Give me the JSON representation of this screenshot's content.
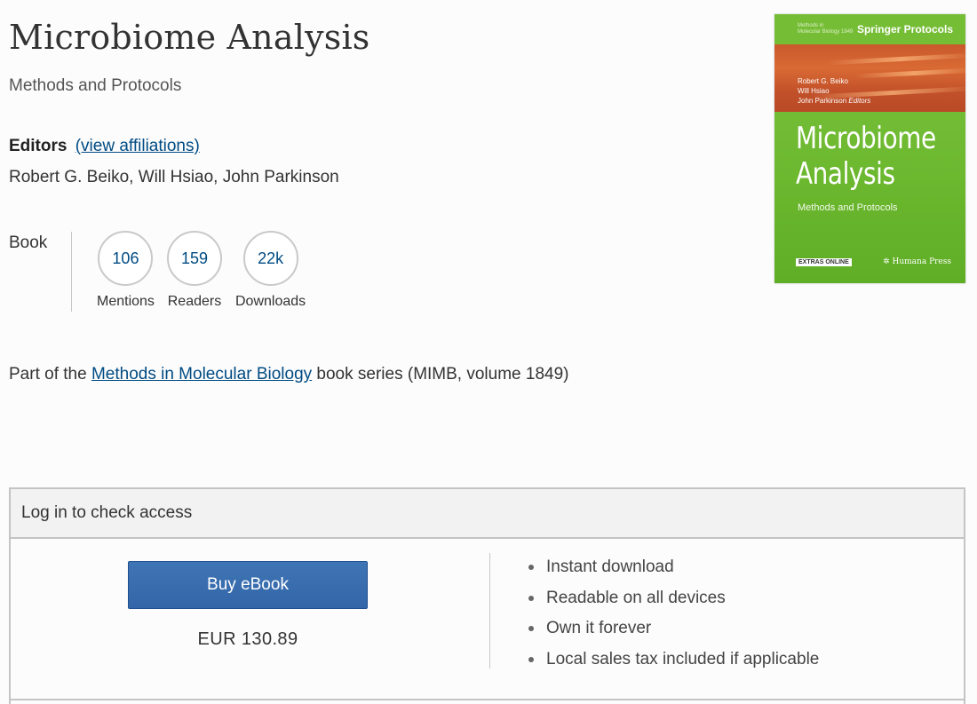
{
  "book": {
    "title": "Microbiome Analysis",
    "subtitle": "Methods and Protocols",
    "editors_label": "Editors",
    "affiliations_link": "(view affiliations)",
    "editors": "Robert G. Beiko, Will Hsiao, John Parkinson"
  },
  "metrics": {
    "type_label": "Book",
    "items": [
      {
        "value": "106",
        "label": "Mentions"
      },
      {
        "value": "159",
        "label": "Readers"
      },
      {
        "value": "22k",
        "label": "Downloads"
      }
    ]
  },
  "series": {
    "prefix": "Part of the",
    "link": "Methods in Molecular Biology",
    "suffix": "book series (MIMB, volume 1849)"
  },
  "cover": {
    "series_small_1": "Methods in",
    "series_small_2": "Molecular Biology  1849",
    "publisher": "Springer Protocols",
    "editor_1": "Robert G. Beiko",
    "editor_2": "Will Hsiao",
    "editor_3": "John Parkinson",
    "editors_tag": "Editors",
    "title_line1": "Microbiome",
    "title_line2": "Analysis",
    "subtitle": "Methods and Protocols",
    "extras": "EXTRAS ONLINE",
    "imprint": "Humana Press",
    "colors": {
      "green": "#6cb82f",
      "orange": "#c9582c"
    }
  },
  "access": {
    "header": "Log in to check access",
    "buy_label": "Buy eBook",
    "price": "EUR 130.89",
    "benefits": [
      "Instant download",
      "Readable on all devices",
      "Own it forever",
      "Local sales tax included if applicable"
    ],
    "button_color": "#3a6eb0"
  }
}
